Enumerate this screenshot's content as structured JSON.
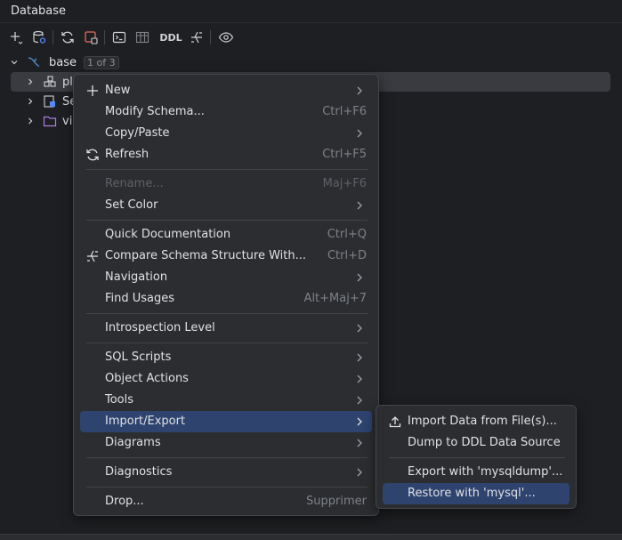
{
  "panel": {
    "title": "Database"
  },
  "toolbar": {
    "ddl_label": "DDL"
  },
  "tree": {
    "root_label": "base",
    "root_badge": "1 of 3",
    "children": [
      {
        "label": "pl",
        "icon": "schema-icon",
        "selected": true
      },
      {
        "label": "Se",
        "icon": "server-objects-icon",
        "selected": false
      },
      {
        "label": "vi",
        "icon": "folder-icon",
        "selected": false
      }
    ]
  },
  "context_menu": {
    "new": "New",
    "modify_schema": "Modify Schema...",
    "modify_schema_sc": "Ctrl+F6",
    "copy_paste": "Copy/Paste",
    "refresh": "Refresh",
    "refresh_sc": "Ctrl+F5",
    "rename": "Rename...",
    "rename_sc": "Maj+F6",
    "set_color": "Set Color",
    "quick_doc": "Quick Documentation",
    "quick_doc_sc": "Ctrl+Q",
    "compare": "Compare Schema Structure With...",
    "compare_sc": "Ctrl+D",
    "navigation": "Navigation",
    "find_usages": "Find Usages",
    "find_usages_sc": "Alt+Maj+7",
    "introspection": "Introspection Level",
    "sql_scripts": "SQL Scripts",
    "object_actions": "Object Actions",
    "tools": "Tools",
    "import_export": "Import/Export",
    "diagrams": "Diagrams",
    "diagnostics": "Diagnostics",
    "drop": "Drop...",
    "drop_sc": "Supprimer"
  },
  "submenu": {
    "import_data": "Import Data from File(s)...",
    "dump_ddl": "Dump to DDL Data Source",
    "export_mysqldump": "Export with 'mysqldump'...",
    "restore_mysql": "Restore with 'mysql'..."
  },
  "colors": {
    "background": "#1e1f22",
    "menu": "#2b2d30",
    "highlight": "#2e436e",
    "accent": "#3574f0"
  }
}
